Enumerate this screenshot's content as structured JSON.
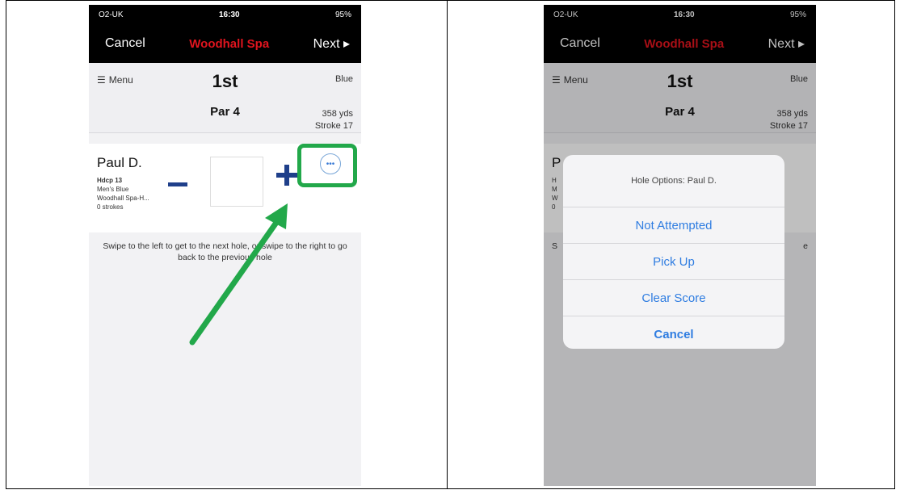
{
  "status": {
    "carrier": "O2-UK",
    "time": "16:30",
    "battery": "95%"
  },
  "nav": {
    "cancel": "Cancel",
    "title": "Woodhall Spa",
    "next": "Next ▸"
  },
  "header": {
    "menu": "Menu",
    "hole": "1st",
    "par": "Par 4",
    "tee": "Blue",
    "yards": "358 yds",
    "stroke": "Stroke 17"
  },
  "player": {
    "name": "Paul D.",
    "hdcp": "Hdcp 13",
    "tee": "Men's Blue",
    "course": "Woodhall Spa-H...",
    "strokes": "0 strokes",
    "initial": "P",
    "d1": "H",
    "d2": "M",
    "d3": "W",
    "d4": "0"
  },
  "hint": "Swipe to the left to get to the next hole, or swipe to the right to go back to the previous hole",
  "hint_partial": {
    "left": "S",
    "right": "e"
  },
  "dialog": {
    "title": "Hole Options: Paul D.",
    "options": [
      "Not Attempted",
      "Pick Up",
      "Clear Score"
    ],
    "cancel": "Cancel"
  },
  "colors": {
    "title_red": "#e0141e",
    "highlight_green": "#22a84a",
    "ios_blue": "#2f7de1",
    "stepper_blue": "#1f3f8a"
  }
}
